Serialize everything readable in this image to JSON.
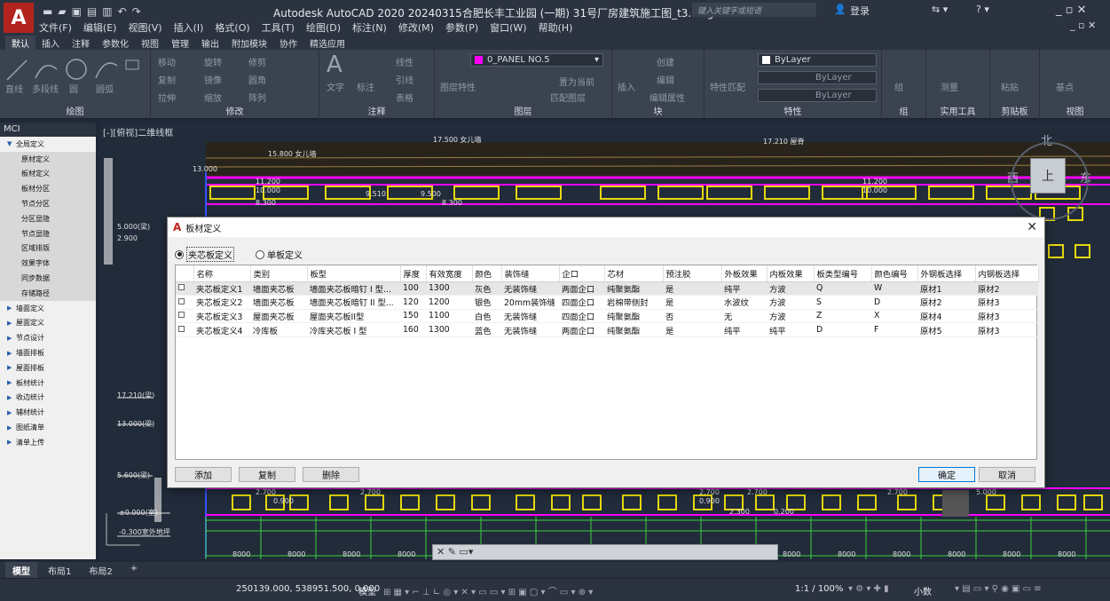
{
  "app": {
    "title": "Autodesk AutoCAD 2020   20240315合肥长丰工业园 (一期) 31号厂房建筑施工图_t3.dwg",
    "search_placeholder": "键入关键字或短语",
    "login": "登录"
  },
  "menus": [
    "文件(F)",
    "编辑(E)",
    "视图(V)",
    "插入(I)",
    "格式(O)",
    "工具(T)",
    "绘图(D)",
    "标注(N)",
    "修改(M)",
    "参数(P)",
    "窗口(W)",
    "帮助(H)"
  ],
  "ribbon_tabs": [
    "默认",
    "插入",
    "注释",
    "参数化",
    "视图",
    "管理",
    "输出",
    "附加模块",
    "协作",
    "精选应用"
  ],
  "ribbon": {
    "draw": {
      "label": "绘图",
      "items": [
        "直线",
        "多段线",
        "圆",
        "圆弧"
      ]
    },
    "modify": {
      "label": "修改",
      "items": [
        "移动",
        "旋转",
        "修剪",
        "复制",
        "镜像",
        "圆角",
        "拉伸",
        "缩放",
        "阵列"
      ]
    },
    "annotation": {
      "label": "注释",
      "items": [
        "文字",
        "标注",
        "线性",
        "引线",
        "表格"
      ]
    },
    "layers": {
      "label": "图层",
      "current": "0_PANEL NO.5",
      "items": [
        "图层特性",
        "置为当前",
        "匹配图层"
      ]
    },
    "block": {
      "label": "块",
      "items": [
        "插入",
        "创建",
        "编辑",
        "编辑属性"
      ]
    },
    "properties": {
      "label": "特性",
      "items": [
        "特性匹配",
        "ByLayer",
        "ByLayer",
        "ByLayer"
      ]
    },
    "groups": {
      "label": "组",
      "items": [
        "组"
      ]
    },
    "utilities": {
      "label": "实用工具",
      "items": [
        "测量"
      ]
    },
    "clipboard": {
      "label": "剪贴板",
      "items": [
        "粘贴"
      ]
    },
    "view": {
      "label": "视图",
      "items": [
        "基点"
      ]
    }
  },
  "sidebar": {
    "header": "MCI",
    "items": [
      {
        "label": "全局定义",
        "expanded": true,
        "children": [
          "原材定义",
          "板材定义",
          "板材分区",
          "节点分区",
          "分区显隐",
          "节点显隐",
          "区域排版",
          "效果字体",
          "同步数据",
          "存储路径"
        ]
      },
      {
        "label": "墙面定义"
      },
      {
        "label": "屋面定义"
      },
      {
        "label": "节点设计"
      },
      {
        "label": "墙面排板"
      },
      {
        "label": "屋面排板"
      },
      {
        "label": "板材统计"
      },
      {
        "label": "收边统计"
      },
      {
        "label": "辅材统计"
      },
      {
        "label": "图纸清单"
      },
      {
        "label": "清单上传"
      }
    ]
  },
  "viewport": {
    "label": "[-][俯视]二维线框",
    "compass": {
      "n": "北",
      "s": "南",
      "e": "东",
      "w": "西",
      "center": "上"
    },
    "dims": [
      "15.800 女儿墙",
      "17.500 女儿墙",
      "17.210 屋脊",
      "13.000",
      "11.200",
      "11.200",
      "10.000",
      "10.000",
      "9.510",
      "9.500",
      "8.300",
      "8.300",
      "5.000(梁)",
      "2.900",
      "17.210(梁)",
      "13.000(梁)",
      "5.600(梁)",
      "±0.000(室)",
      "-0.300室外地坪",
      "2.700",
      "2.700",
      "0.900",
      "0.900",
      "2.300",
      "0.200",
      "2.700",
      "2.700",
      "2.700",
      "5.000",
      "8000",
      "8000",
      "8000",
      "8000",
      "8000",
      "8000",
      "8000",
      "8000",
      "8000",
      "8000",
      "8000",
      "8000",
      "8000",
      "8000",
      "8000",
      "8000"
    ]
  },
  "dialog": {
    "title": "板材定义",
    "radio1": "夹芯板定义",
    "radio2": "单板定义",
    "columns": [
      "名称",
      "类别",
      "板型",
      "厚度",
      "有效宽度",
      "颜色",
      "装饰缝",
      "企口",
      "芯材",
      "预注胶",
      "外板效果",
      "内板效果",
      "板类型编号",
      "颜色编号",
      "外钢板选择",
      "内钢板选择"
    ],
    "rows": [
      [
        "夹芯板定义1",
        "墙面夹芯板",
        "墙面夹芯板暗钉 I 型...",
        "100",
        "1300",
        "灰色",
        "无装饰缝",
        "两面企口",
        "纯聚氨酯",
        "是",
        "纯平",
        "方波",
        "Q",
        "W",
        "原材1",
        "原材2"
      ],
      [
        "夹芯板定义2",
        "墙面夹芯板",
        "墙面夹芯板暗钉 II 型...",
        "120",
        "1200",
        "银色",
        "20mm装饰缝",
        "四面企口",
        "岩棉带侧封",
        "是",
        "水波纹",
        "方波",
        "S",
        "D",
        "原材2",
        "原材3"
      ],
      [
        "夹芯板定义3",
        "屋面夹芯板",
        "屋面夹芯板II型",
        "150",
        "1100",
        "白色",
        "无装饰缝",
        "四面企口",
        "纯聚氨酯",
        "否",
        "无",
        "方波",
        "Z",
        "X",
        "原材4",
        "原材3"
      ],
      [
        "夹芯板定义4",
        "冷库板",
        "冷库夹芯板 I 型",
        "160",
        "1300",
        "蓝色",
        "无装饰缝",
        "两面企口",
        "纯聚氨酯",
        "是",
        "纯平",
        "纯平",
        "D",
        "F",
        "原材5",
        "原材3"
      ]
    ],
    "buttons": {
      "add": "添加",
      "copy": "复制",
      "delete": "删除",
      "ok": "确定",
      "cancel": "取消"
    }
  },
  "layout_tabs": [
    "模型",
    "布局1",
    "布局2",
    "+"
  ],
  "status": {
    "coords": "250139.000, 538951.500, 0.000",
    "model": "模型",
    "scale": "1:1 / 100%",
    "units": "小数"
  },
  "colors": {
    "accent_magenta": "#ff00ff",
    "dialog_bg": "#f0f0f0",
    "autocad_red": "#c0211b"
  }
}
